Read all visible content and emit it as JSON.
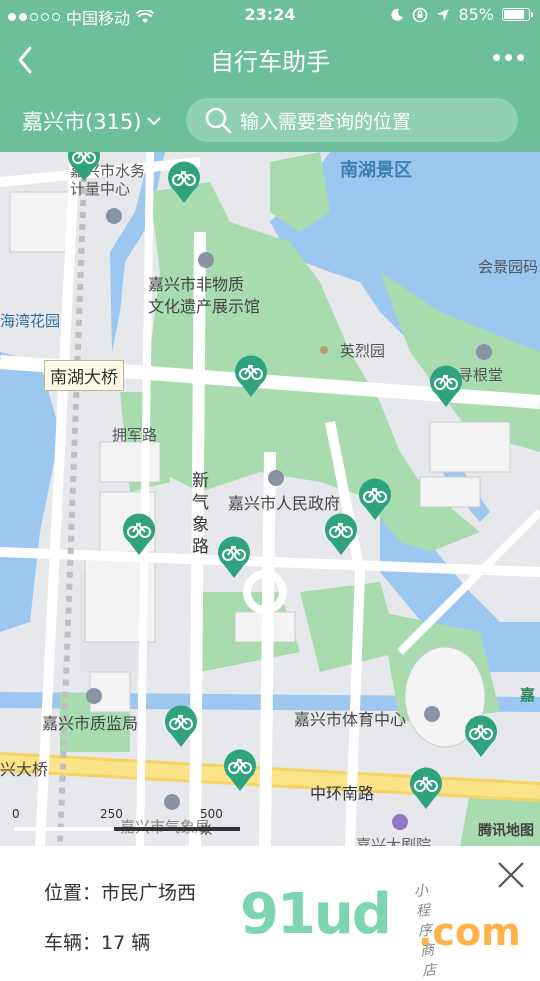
{
  "status": {
    "carrier": "中国移动",
    "time": "23:24",
    "battery": "85%"
  },
  "nav": {
    "title": "自行车助手"
  },
  "search": {
    "city": "嘉兴市(315)",
    "placeholder": "输入需要查询的位置"
  },
  "map": {
    "labels": {
      "water_center": "嘉兴市水务\n计量中心",
      "nanhu": "南湖景区",
      "heritage": "嘉兴市非物质\n文化遗产展示馆",
      "huijing": "会景园码",
      "haiwan": "海湾花园",
      "lieshi": "英烈园",
      "xungen": "寻根堂",
      "bridge": "南湖大桥",
      "yongjun": "拥军路",
      "xinqixiang": "新\n气\n象\n路",
      "gov": "嘉兴市人民政府",
      "zhijian": "嘉兴市质监局",
      "tiyu": "嘉兴市体育中心",
      "xing": "兴大桥",
      "zhonghuan": "中环南路",
      "qixiang": "嘉兴市气象局",
      "juyuan": "嘉兴大剧院",
      "jia": "嘉"
    },
    "scale": [
      "0",
      "250",
      "500 米"
    ],
    "brand": "腾讯地图"
  },
  "info": {
    "location": "位置：市民广场西",
    "bikes": "车辆：17 辆"
  },
  "watermark": {
    "main": "91ud",
    "domain": ".com",
    "sub": "小程序商店"
  },
  "colors": {
    "accent": "#6dbf9c",
    "pin": "#2ea37e"
  }
}
